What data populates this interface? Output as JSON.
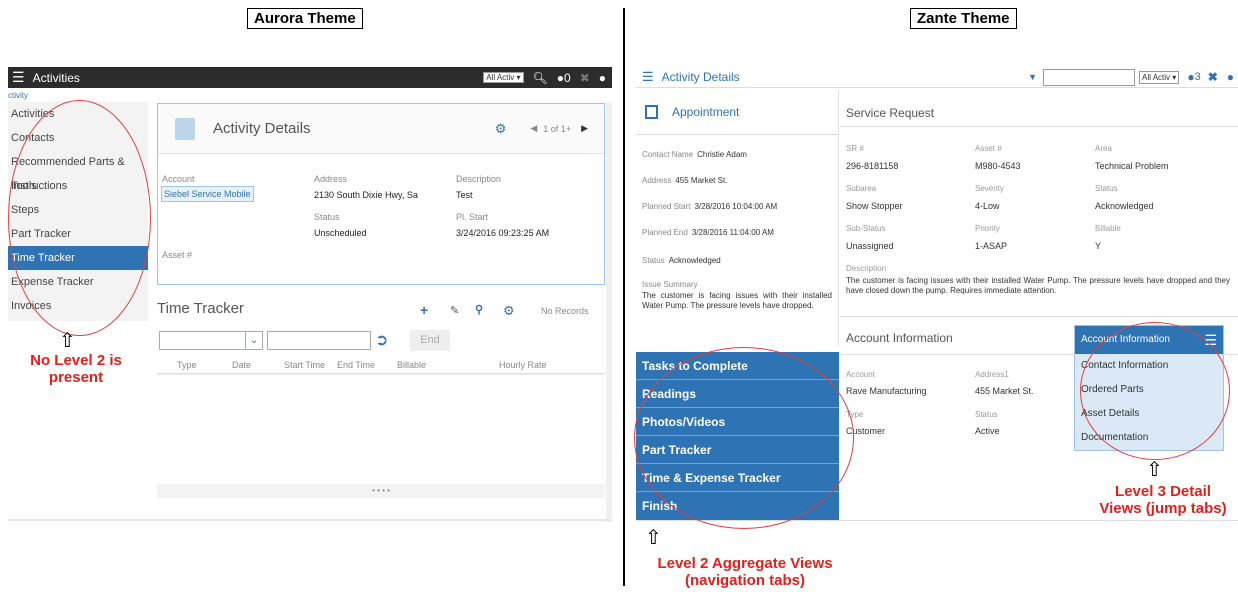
{
  "aurora": {
    "theme_title": "Aurora Theme",
    "header": {
      "title": "Activities",
      "select": "All Activ"
    },
    "breadcrumb": "ctivity",
    "sidebar": [
      "Activities",
      "Contacts",
      "Recommended Parts & Tools",
      "Instructions",
      "Steps",
      "Part Tracker",
      "Time Tracker",
      "Expense Tracker",
      "Invoices"
    ],
    "selected_item": "Time Tracker",
    "details": {
      "title": "Activity Details",
      "pager": "1 of 1+",
      "account_label": "Account",
      "account_value": "Siebel Service Mobile",
      "address_label": "Address",
      "address_value": "2130 South Dixie Hwy, Sa",
      "description_label": "Description",
      "description_value": "Test",
      "status_label": "Status",
      "status_value": "Unscheduled",
      "plstart_label": "Pl. Start",
      "plstart_value": "3/24/2016 09:23:25 AM",
      "asset_label": "Asset #"
    },
    "time_tracker": {
      "title": "Time Tracker",
      "no_records": "No Records",
      "end_label": "End",
      "columns": [
        "Type",
        "Date",
        "Start Time",
        "End Time",
        "Billable",
        "Hourly Rate"
      ]
    },
    "callout": "No Level 2 is present"
  },
  "zante": {
    "theme_title": "Zante Theme",
    "header": {
      "title": "Activity Details",
      "select": "All Activ",
      "count": "3"
    },
    "appointment": {
      "title": "Appointment",
      "contact_label": "Contact Name",
      "contact_value": "Christie Adam",
      "address_label": "Address",
      "address_value": "455 Market St.",
      "pstart_label": "Planned Start",
      "pstart_value": "3/28/2016 10:04:00 AM",
      "pend_label": "Planned End",
      "pend_value": "3/28/2016 11:04:00 AM",
      "status_label": "Status",
      "status_value": "Acknowledged",
      "summary_label": "Issue Summary",
      "summary_value": "The customer is facing issues with their installed Water Pump. The pressure levels have dropped."
    },
    "nav_tabs": [
      "Tasks to Complete",
      "Readings",
      "Photos/Videos",
      "Part Tracker",
      "Time & Expense Tracker",
      "Finish"
    ],
    "service_request": {
      "title": "Service Request",
      "sr_label": "SR #",
      "sr_value": "296-8181158",
      "asset_label": "Asset #",
      "asset_value": "M980-4543",
      "area_label": "Area",
      "area_value": "Technical Problem",
      "subarea_label": "Subarea",
      "subarea_value": "Show Stopper",
      "severity_label": "Severity",
      "severity_value": "4-Low",
      "status_label": "Status",
      "status_value": "Acknowledged",
      "substatus_label": "Sub-Status",
      "substatus_value": "Unassigned",
      "priority_label": "Priority",
      "priority_value": "1-ASAP",
      "billable_label": "Billable",
      "billable_value": "Y",
      "description_label": "Description",
      "description_value": "The customer is facing issues with their installed Water Pump. The pressure levels have dropped and they have closed down the pump. Requires immediate attention."
    },
    "account_info": {
      "title": "Account Information",
      "account_label": "Account",
      "account_value": "Rave Manufacturing",
      "address_label": "Address1",
      "address_value": "455 Market St.",
      "type_label": "Type",
      "type_value": "Customer",
      "status_label": "Status",
      "status_value": "Active"
    },
    "jump_tabs": [
      "Account Information",
      "Contact Information",
      "Ordered Parts",
      "Asset Details",
      "Documentation"
    ],
    "callout_level2": "Level 2 Aggregate Views (navigation tabs)",
    "callout_level3": "Level 3 Detail Views (jump tabs)"
  }
}
